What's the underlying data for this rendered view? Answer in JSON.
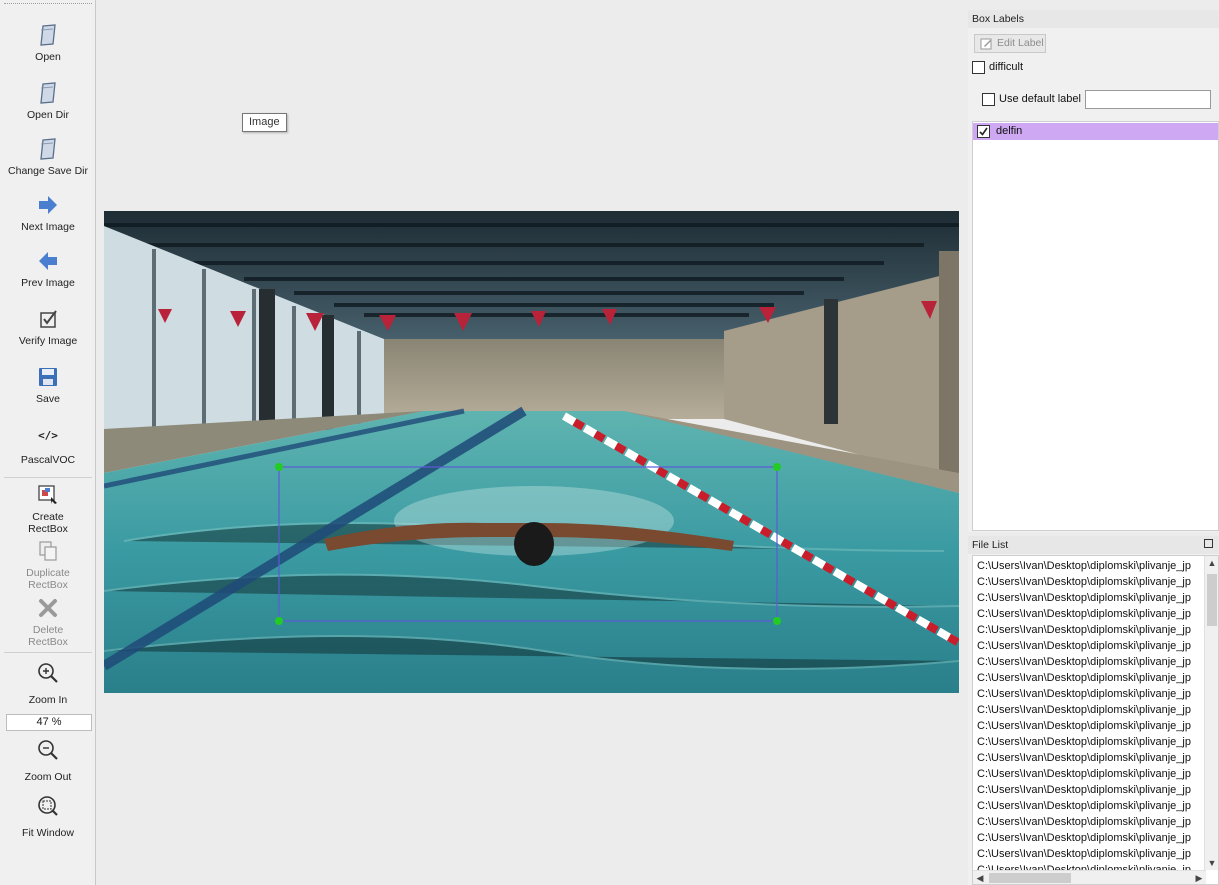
{
  "toolbar": {
    "open": "Open",
    "open_dir": "Open Dir",
    "change_save_dir": "Change Save Dir",
    "next_image": "Next Image",
    "prev_image": "Prev Image",
    "verify_image": "Verify Image",
    "save": "Save",
    "format_icon_text": "</>",
    "format": "PascalVOC",
    "create_rectbox": "Create\nRectBox",
    "duplicate_rectbox": "Duplicate\nRectBox",
    "delete_rectbox": "Delete\nRectBox",
    "zoom_in": "Zoom In",
    "zoom_value": "47 %",
    "zoom_out": "Zoom Out",
    "fit_window": "Fit Window"
  },
  "canvas": {
    "tooltip": "Image",
    "photo_icon": "swimming-pool-photo",
    "bounding_box_color": "#5b5bd6",
    "handle_color": "#22cc22"
  },
  "box_labels": {
    "title": "Box Labels",
    "edit_label": "Edit Label",
    "difficult": "difficult",
    "difficult_checked": false,
    "use_default_label": "Use default label",
    "use_default_checked": false,
    "default_label_value": "",
    "labels": [
      {
        "name": "delfin",
        "checked": true,
        "color": "#cfa8f3"
      }
    ]
  },
  "file_list": {
    "title": "File List",
    "files": [
      "C:\\Users\\Ivan\\Desktop\\diplomski\\plivanje_jp",
      "C:\\Users\\Ivan\\Desktop\\diplomski\\plivanje_jp",
      "C:\\Users\\Ivan\\Desktop\\diplomski\\plivanje_jp",
      "C:\\Users\\Ivan\\Desktop\\diplomski\\plivanje_jp",
      "C:\\Users\\Ivan\\Desktop\\diplomski\\plivanje_jp",
      "C:\\Users\\Ivan\\Desktop\\diplomski\\plivanje_jp",
      "C:\\Users\\Ivan\\Desktop\\diplomski\\plivanje_jp",
      "C:\\Users\\Ivan\\Desktop\\diplomski\\plivanje_jp",
      "C:\\Users\\Ivan\\Desktop\\diplomski\\plivanje_jp",
      "C:\\Users\\Ivan\\Desktop\\diplomski\\plivanje_jp",
      "C:\\Users\\Ivan\\Desktop\\diplomski\\plivanje_jp",
      "C:\\Users\\Ivan\\Desktop\\diplomski\\plivanje_jp",
      "C:\\Users\\Ivan\\Desktop\\diplomski\\plivanje_jp",
      "C:\\Users\\Ivan\\Desktop\\diplomski\\plivanje_jp",
      "C:\\Users\\Ivan\\Desktop\\diplomski\\plivanje_jp",
      "C:\\Users\\Ivan\\Desktop\\diplomski\\plivanje_jp",
      "C:\\Users\\Ivan\\Desktop\\diplomski\\plivanje_jp",
      "C:\\Users\\Ivan\\Desktop\\diplomski\\plivanje_jp",
      "C:\\Users\\Ivan\\Desktop\\diplomski\\plivanje_jp",
      "C:\\Users\\Ivan\\Desktop\\diplomski\\plivanje_jp"
    ]
  }
}
